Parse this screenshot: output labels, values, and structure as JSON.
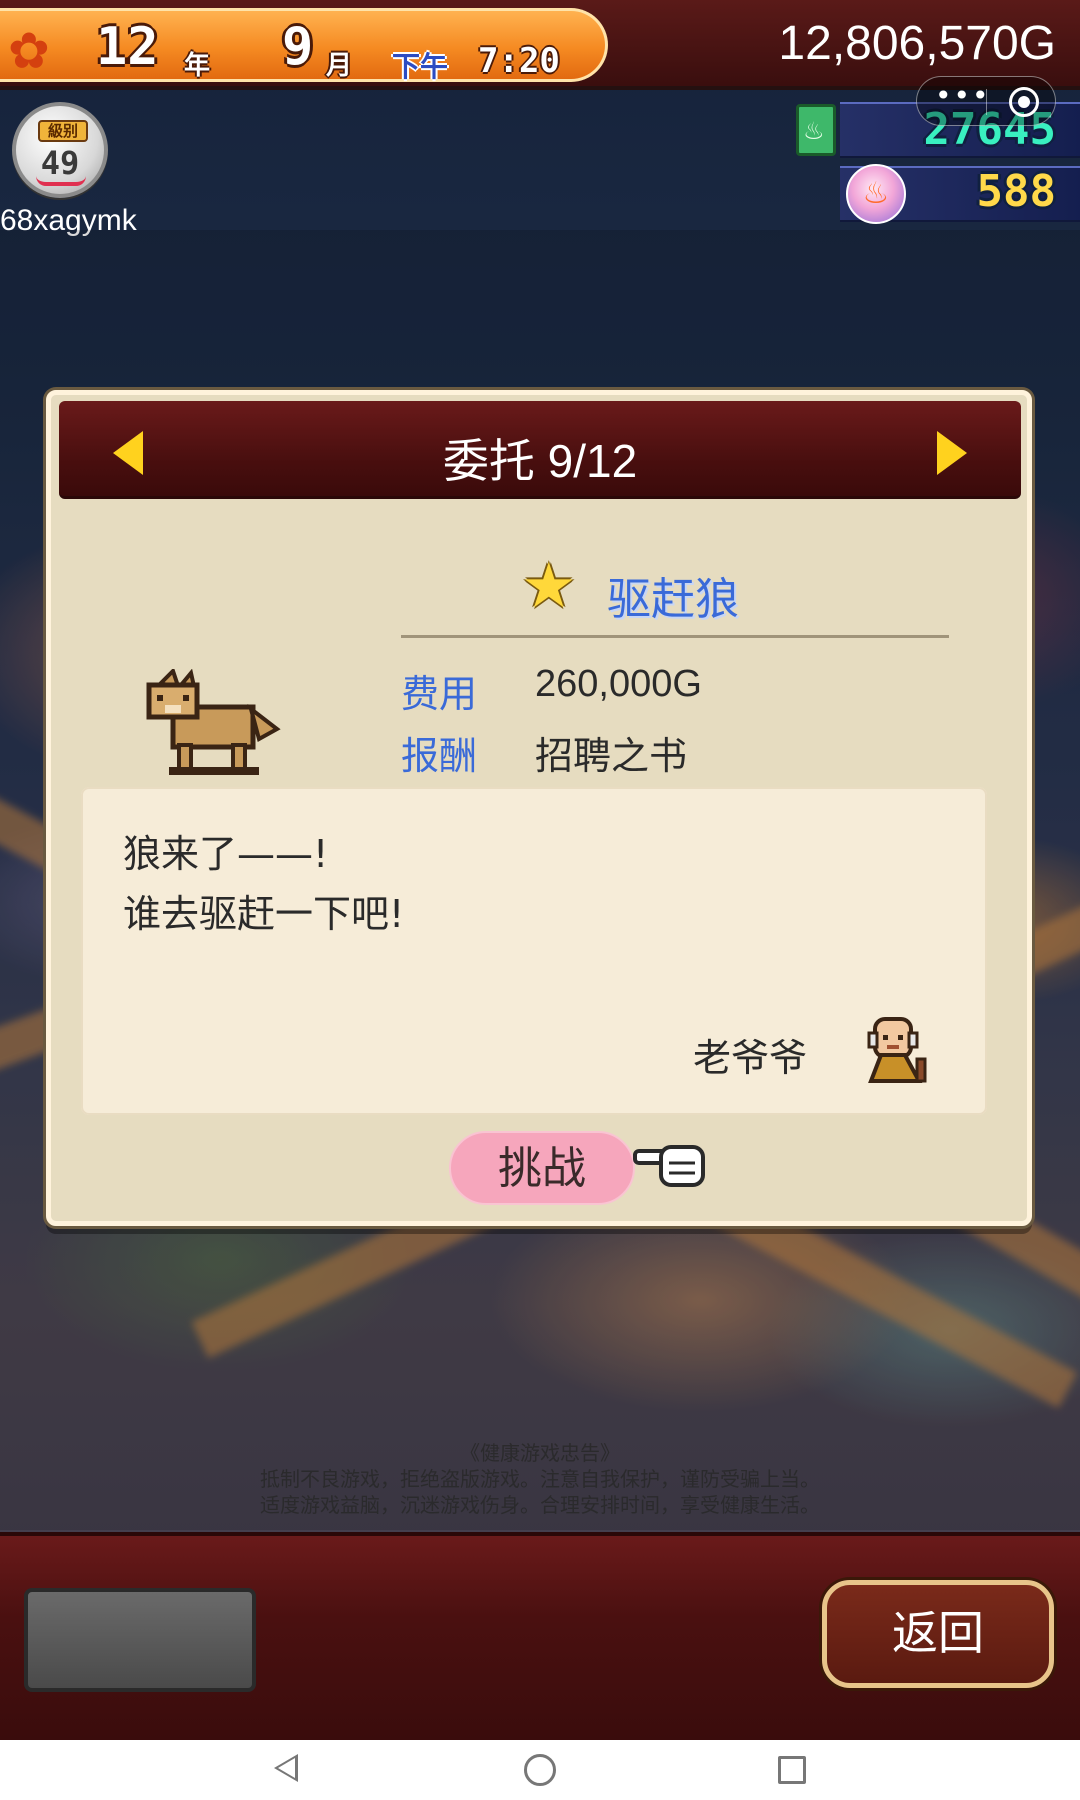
{
  "status_bar": {
    "year": "12",
    "year_unit": "年",
    "month": "9",
    "month_unit": "月",
    "period": "下午",
    "time": "7:20",
    "money": "12,806,570G"
  },
  "player": {
    "level_label": "級别",
    "level": "49",
    "name": "68xagymk"
  },
  "resources": {
    "books": "27645",
    "hot_springs": "588"
  },
  "dialog": {
    "title": "委托 9/12",
    "quest_name": "驱赶狼",
    "cost_label": "费用",
    "cost_value": "260,000G",
    "reward_label": "报酬",
    "reward_value": "招聘之书",
    "message_line1": "狼来了——!",
    "message_line2": "谁去驱赶一下吧!",
    "sender": "老爷爷",
    "challenge_button": "挑战"
  },
  "notice": {
    "title": "《健康游戏忠告》",
    "line1": "抵制不良游戏，拒绝盗版游戏。注意自我保护，谨防受骗上当。",
    "line2": "适度游戏益脑，沉迷游戏伤身。合理安排时间，享受健康生活。"
  },
  "bottom": {
    "back_button": "返回"
  },
  "colors": {
    "accent_date": "#f58a22",
    "header_maroon": "#4a0f0f",
    "quest_blue": "#3a6ad8",
    "challenge_pink": "#f6a6bc"
  }
}
